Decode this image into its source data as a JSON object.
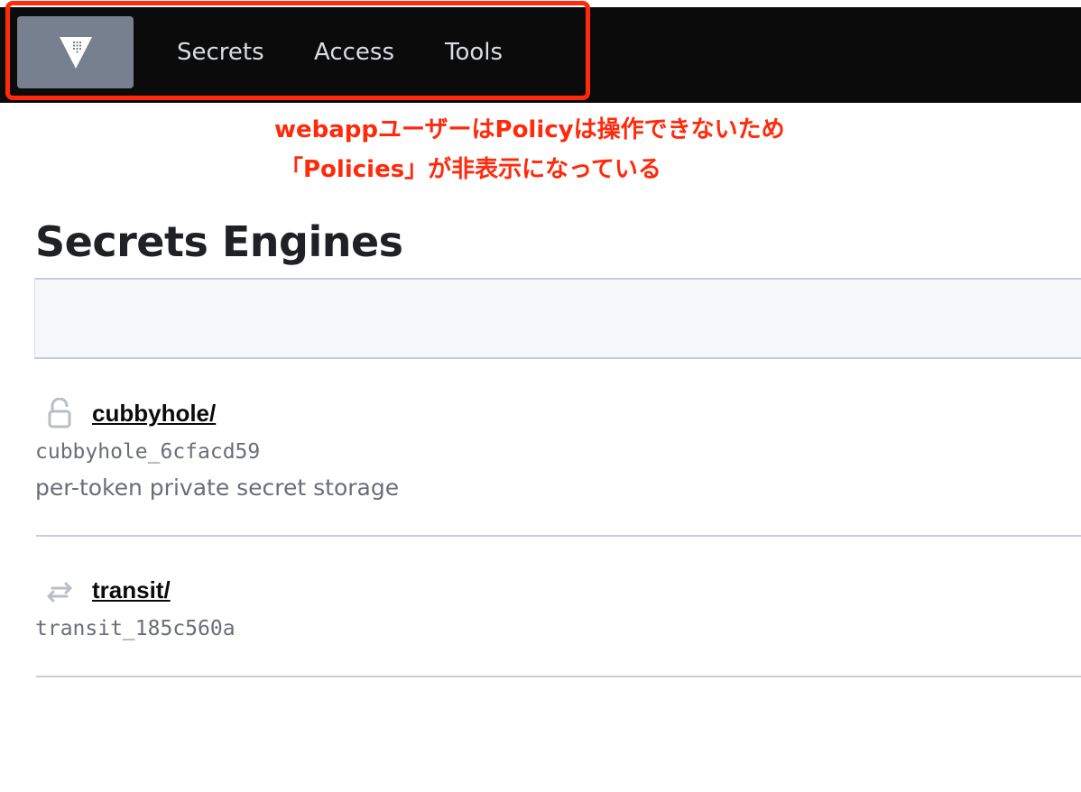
{
  "nav": {
    "logo_icon": "vault-triangle-icon",
    "items": [
      {
        "label": "Secrets"
      },
      {
        "label": "Access"
      },
      {
        "label": "Tools"
      }
    ]
  },
  "annotation": {
    "line1": "webappユーザーはPolicyは操作できないため",
    "line2": "「Policies」が非表示になっている",
    "color": "#ff2a0b"
  },
  "main": {
    "title": "Secrets Engines",
    "engines": [
      {
        "name": "cubbyhole/",
        "icon": "unlocked-padlock-icon",
        "accessor": "cubbyhole_6cfacd59",
        "description": "per-token private secret storage"
      },
      {
        "name": "transit/",
        "icon": "transit-arrows-icon",
        "accessor": "transit_185c560a",
        "description": ""
      }
    ]
  },
  "colors": {
    "topbar_bg": "#0b0b0c",
    "logo_bg": "#77808f",
    "nav_text": "#d9dce1",
    "muted_text": "#6a6e78"
  }
}
